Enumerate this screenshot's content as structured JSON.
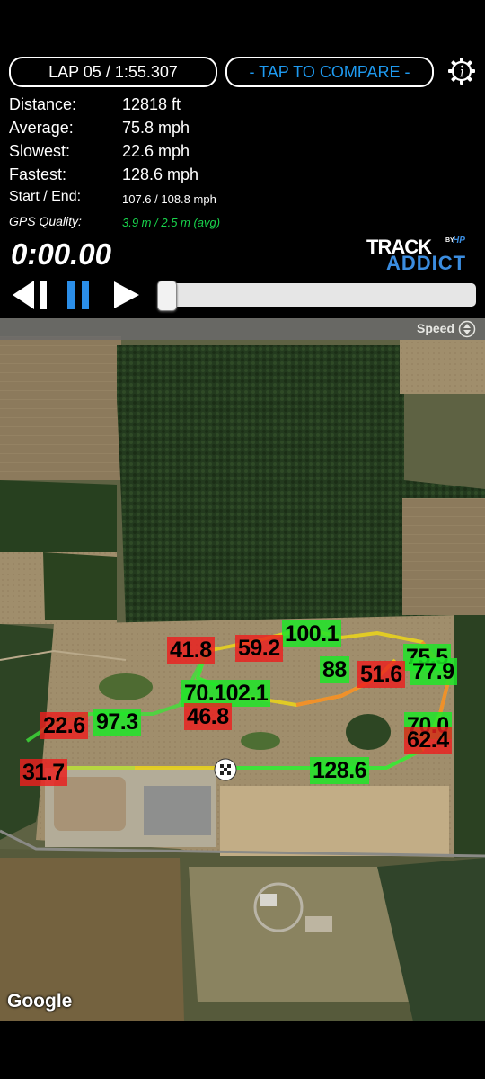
{
  "header": {
    "lap_label": "LAP 05 / 1:55.307",
    "compare_label": "- TAP TO COMPARE -"
  },
  "stats": [
    {
      "label": "Distance:",
      "value": "12818 ft"
    },
    {
      "label": "Average:",
      "value": "75.8 mph"
    },
    {
      "label": "Slowest:",
      "value": "22.6 mph"
    },
    {
      "label": "Fastest:",
      "value": "128.6 mph"
    },
    {
      "label": "Start / End:",
      "value": "107.6 / 108.8 mph"
    },
    {
      "label": "GPS Quality:",
      "value": "3.9 m / 2.5 m (avg)"
    }
  ],
  "timer": "0:00.00",
  "logo": {
    "line1": "TRACK",
    "line2": "ADDICT",
    "by": "BY",
    "hp": "HP"
  },
  "playback": {
    "position": 0
  },
  "map": {
    "overlay_mode": "Speed",
    "attribution": "Google",
    "speed_labels": [
      {
        "text": "100.1",
        "color": "green"
      },
      {
        "text": "41.8",
        "color": "red"
      },
      {
        "text": "59.2",
        "color": "red"
      },
      {
        "text": "75.5",
        "color": "green"
      },
      {
        "text": "88",
        "color": "green"
      },
      {
        "text": "51.6",
        "color": "red"
      },
      {
        "text": "77.9",
        "color": "green"
      },
      {
        "text": "70.102.1",
        "color": "green"
      },
      {
        "text": "46.8",
        "color": "red"
      },
      {
        "text": "22.6",
        "color": "red"
      },
      {
        "text": "97.3",
        "color": "green"
      },
      {
        "text": "70.0",
        "color": "green"
      },
      {
        "text": "62.4",
        "color": "red"
      },
      {
        "text": "31.7",
        "color": "red"
      },
      {
        "text": "128.6",
        "color": "green"
      }
    ]
  },
  "colors": {
    "accent": "#1e9af0",
    "gps_quality": "#19d44c",
    "fast": "#1ee628",
    "slow": "#eb1e1e"
  }
}
